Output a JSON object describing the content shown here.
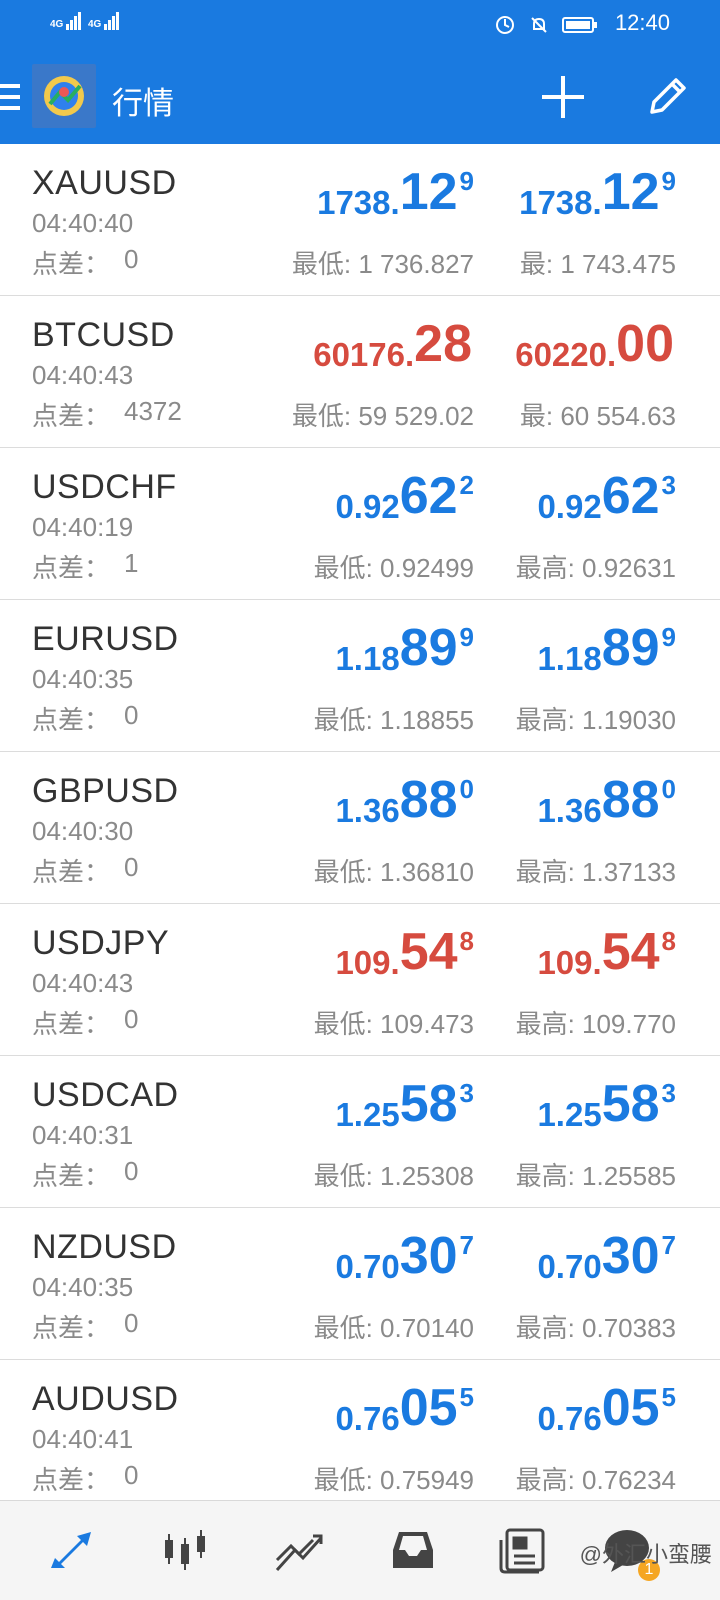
{
  "status_bar": {
    "signal_1": "4G",
    "signal_2": "4G",
    "time": "12:40"
  },
  "app_bar": {
    "title": "行情",
    "icons": [
      "menu-icon",
      "app-logo-icon",
      "add-icon",
      "edit-pencil-icon"
    ]
  },
  "colors": {
    "primary": "#1a7ae0",
    "up": "#1a7ae0",
    "down": "#d64b3f",
    "muted": "#8a8a8a"
  },
  "spread_label": "点差：",
  "quotes": [
    {
      "symbol": "XAUUSD",
      "time": "04:40:40",
      "spread": "0",
      "bid": {
        "small": "1738.",
        "big": "12",
        "sup": "9"
      },
      "ask": {
        "small": "1738.",
        "big": "12",
        "sup": "9"
      },
      "low": "最低: 1 736.827",
      "high": "最: 1 743.475",
      "color": "blue"
    },
    {
      "symbol": "BTCUSD",
      "time": "04:40:43",
      "spread": "4372",
      "bid": {
        "small": "60176.",
        "big": "28",
        "sup": ""
      },
      "ask": {
        "small": "60220.",
        "big": "00",
        "sup": ""
      },
      "low": "最低: 59 529.02",
      "high": "最: 60 554.63",
      "color": "red"
    },
    {
      "symbol": "USDCHF",
      "time": "04:40:19",
      "spread": "1",
      "bid": {
        "small": "0.92",
        "big": "62",
        "sup": "2"
      },
      "ask": {
        "small": "0.92",
        "big": "62",
        "sup": "3"
      },
      "low": "最低: 0.92499",
      "high": "最高: 0.92631",
      "color": "blue"
    },
    {
      "symbol": "EURUSD",
      "time": "04:40:35",
      "spread": "0",
      "bid": {
        "small": "1.18",
        "big": "89",
        "sup": "9"
      },
      "ask": {
        "small": "1.18",
        "big": "89",
        "sup": "9"
      },
      "low": "最低: 1.18855",
      "high": "最高: 1.19030",
      "color": "blue"
    },
    {
      "symbol": "GBPUSD",
      "time": "04:40:30",
      "spread": "0",
      "bid": {
        "small": "1.36",
        "big": "88",
        "sup": "0"
      },
      "ask": {
        "small": "1.36",
        "big": "88",
        "sup": "0"
      },
      "low": "最低: 1.36810",
      "high": "最高: 1.37133",
      "color": "blue"
    },
    {
      "symbol": "USDJPY",
      "time": "04:40:43",
      "spread": "0",
      "bid": {
        "small": "109.",
        "big": "54",
        "sup": "8"
      },
      "ask": {
        "small": "109.",
        "big": "54",
        "sup": "8"
      },
      "low": "最低: 109.473",
      "high": "最高: 109.770",
      "color": "red"
    },
    {
      "symbol": "USDCAD",
      "time": "04:40:31",
      "spread": "0",
      "bid": {
        "small": "1.25",
        "big": "58",
        "sup": "3"
      },
      "ask": {
        "small": "1.25",
        "big": "58",
        "sup": "3"
      },
      "low": "最低: 1.25308",
      "high": "最高: 1.25585",
      "color": "blue"
    },
    {
      "symbol": "NZDUSD",
      "time": "04:40:35",
      "spread": "0",
      "bid": {
        "small": "0.70",
        "big": "30",
        "sup": "7"
      },
      "ask": {
        "small": "0.70",
        "big": "30",
        "sup": "7"
      },
      "low": "最低: 0.70140",
      "high": "最高: 0.70383",
      "color": "blue"
    },
    {
      "symbol": "AUDUSD",
      "time": "04:40:41",
      "spread": "0",
      "bid": {
        "small": "0.76",
        "big": "05",
        "sup": "5"
      },
      "ask": {
        "small": "0.76",
        "big": "05",
        "sup": "5"
      },
      "low": "最低: 0.75949",
      "high": "最高: 0.76234",
      "color": "blue"
    }
  ],
  "bottom_nav": {
    "items": [
      "quotes-arrows-icon",
      "chart-candles-icon",
      "trade-line-icon",
      "history-inbox-icon",
      "news-icon",
      "chat-icon"
    ],
    "active_index": 0,
    "watermark": "@外汇小蛮腰",
    "badge": "1"
  }
}
